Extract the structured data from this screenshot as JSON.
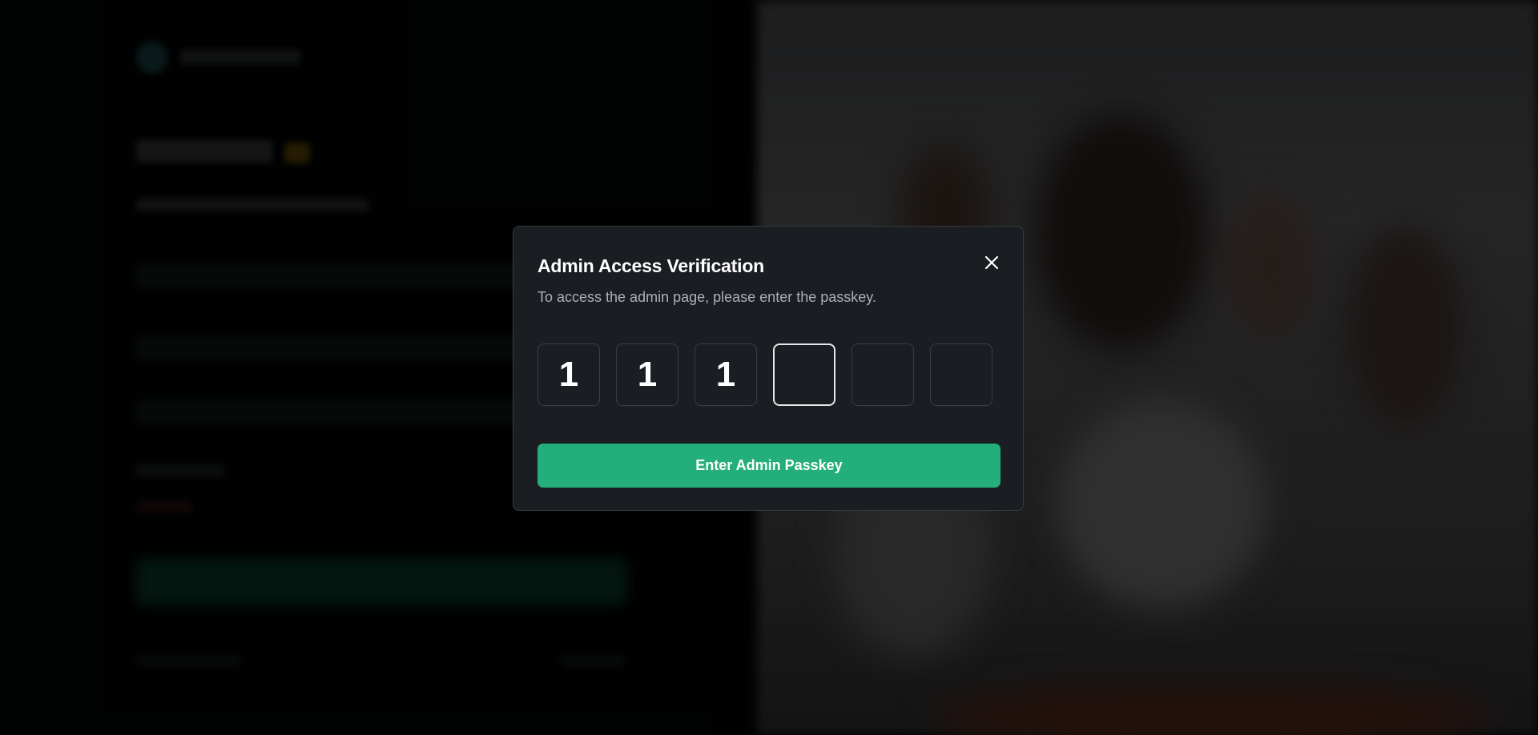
{
  "modal": {
    "title": "Admin Access Verification",
    "subtitle": "To access the admin page, please enter the passkey.",
    "close_icon": "close-icon",
    "otp": [
      "1",
      "1",
      "1",
      "",
      "",
      ""
    ],
    "active_index": 3,
    "submit_label": "Enter Admin Passkey"
  },
  "colors": {
    "accent": "#24ae7c",
    "modal_bg": "#1a1d21",
    "subtitle": "#a9b0ba"
  }
}
